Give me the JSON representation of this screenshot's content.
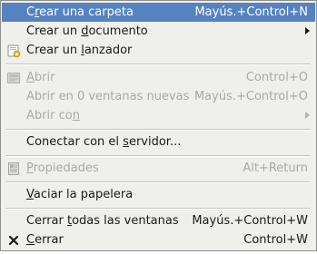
{
  "menu": {
    "create_folder": {
      "label_pre": "C",
      "label_mn": "r",
      "label_post": "ear una carpeta",
      "accel": "Mayús.+Control+N"
    },
    "create_document": {
      "label_pre": "Crear un ",
      "label_mn": "d",
      "label_post": "ocumento"
    },
    "create_launcher": {
      "label_pre": "Crear un ",
      "label_mn": "l",
      "label_post": "anzador",
      "icon": "launcher-icon"
    },
    "open": {
      "label_pre": "",
      "label_mn": "A",
      "label_post": "brir",
      "accel": "Control+O",
      "icon": "open-icon"
    },
    "open_in_windows": {
      "label": "Abrir en 0 ventanas nuevas",
      "accel": "Mayús.+Control+O"
    },
    "open_with": {
      "label_pre": "Abrir co",
      "label_mn": "n",
      "label_post": ""
    },
    "connect_server": {
      "label_pre": "Conectar con el ",
      "label_mn": "s",
      "label_post": "ervidor..."
    },
    "properties": {
      "label_pre": "",
      "label_mn": "P",
      "label_post": "ropiedades",
      "accel": "Alt+Return",
      "icon": "properties-icon"
    },
    "empty_trash": {
      "label_pre": "",
      "label_mn": "V",
      "label_post": "aciar la papelera"
    },
    "close_all": {
      "label_pre": "Cerrar ",
      "label_mn": "t",
      "label_post": "odas las ventanas",
      "accel": "Mayús.+Control+W"
    },
    "close": {
      "label_pre": "",
      "label_mn": "C",
      "label_post": "errar",
      "accel": "Control+W",
      "icon": "close-icon"
    }
  },
  "colors": {
    "menu_background": "#efefec",
    "highlight": "#5583c1",
    "text": "#1a1a1a",
    "disabled_text": "#a9a9a5"
  }
}
